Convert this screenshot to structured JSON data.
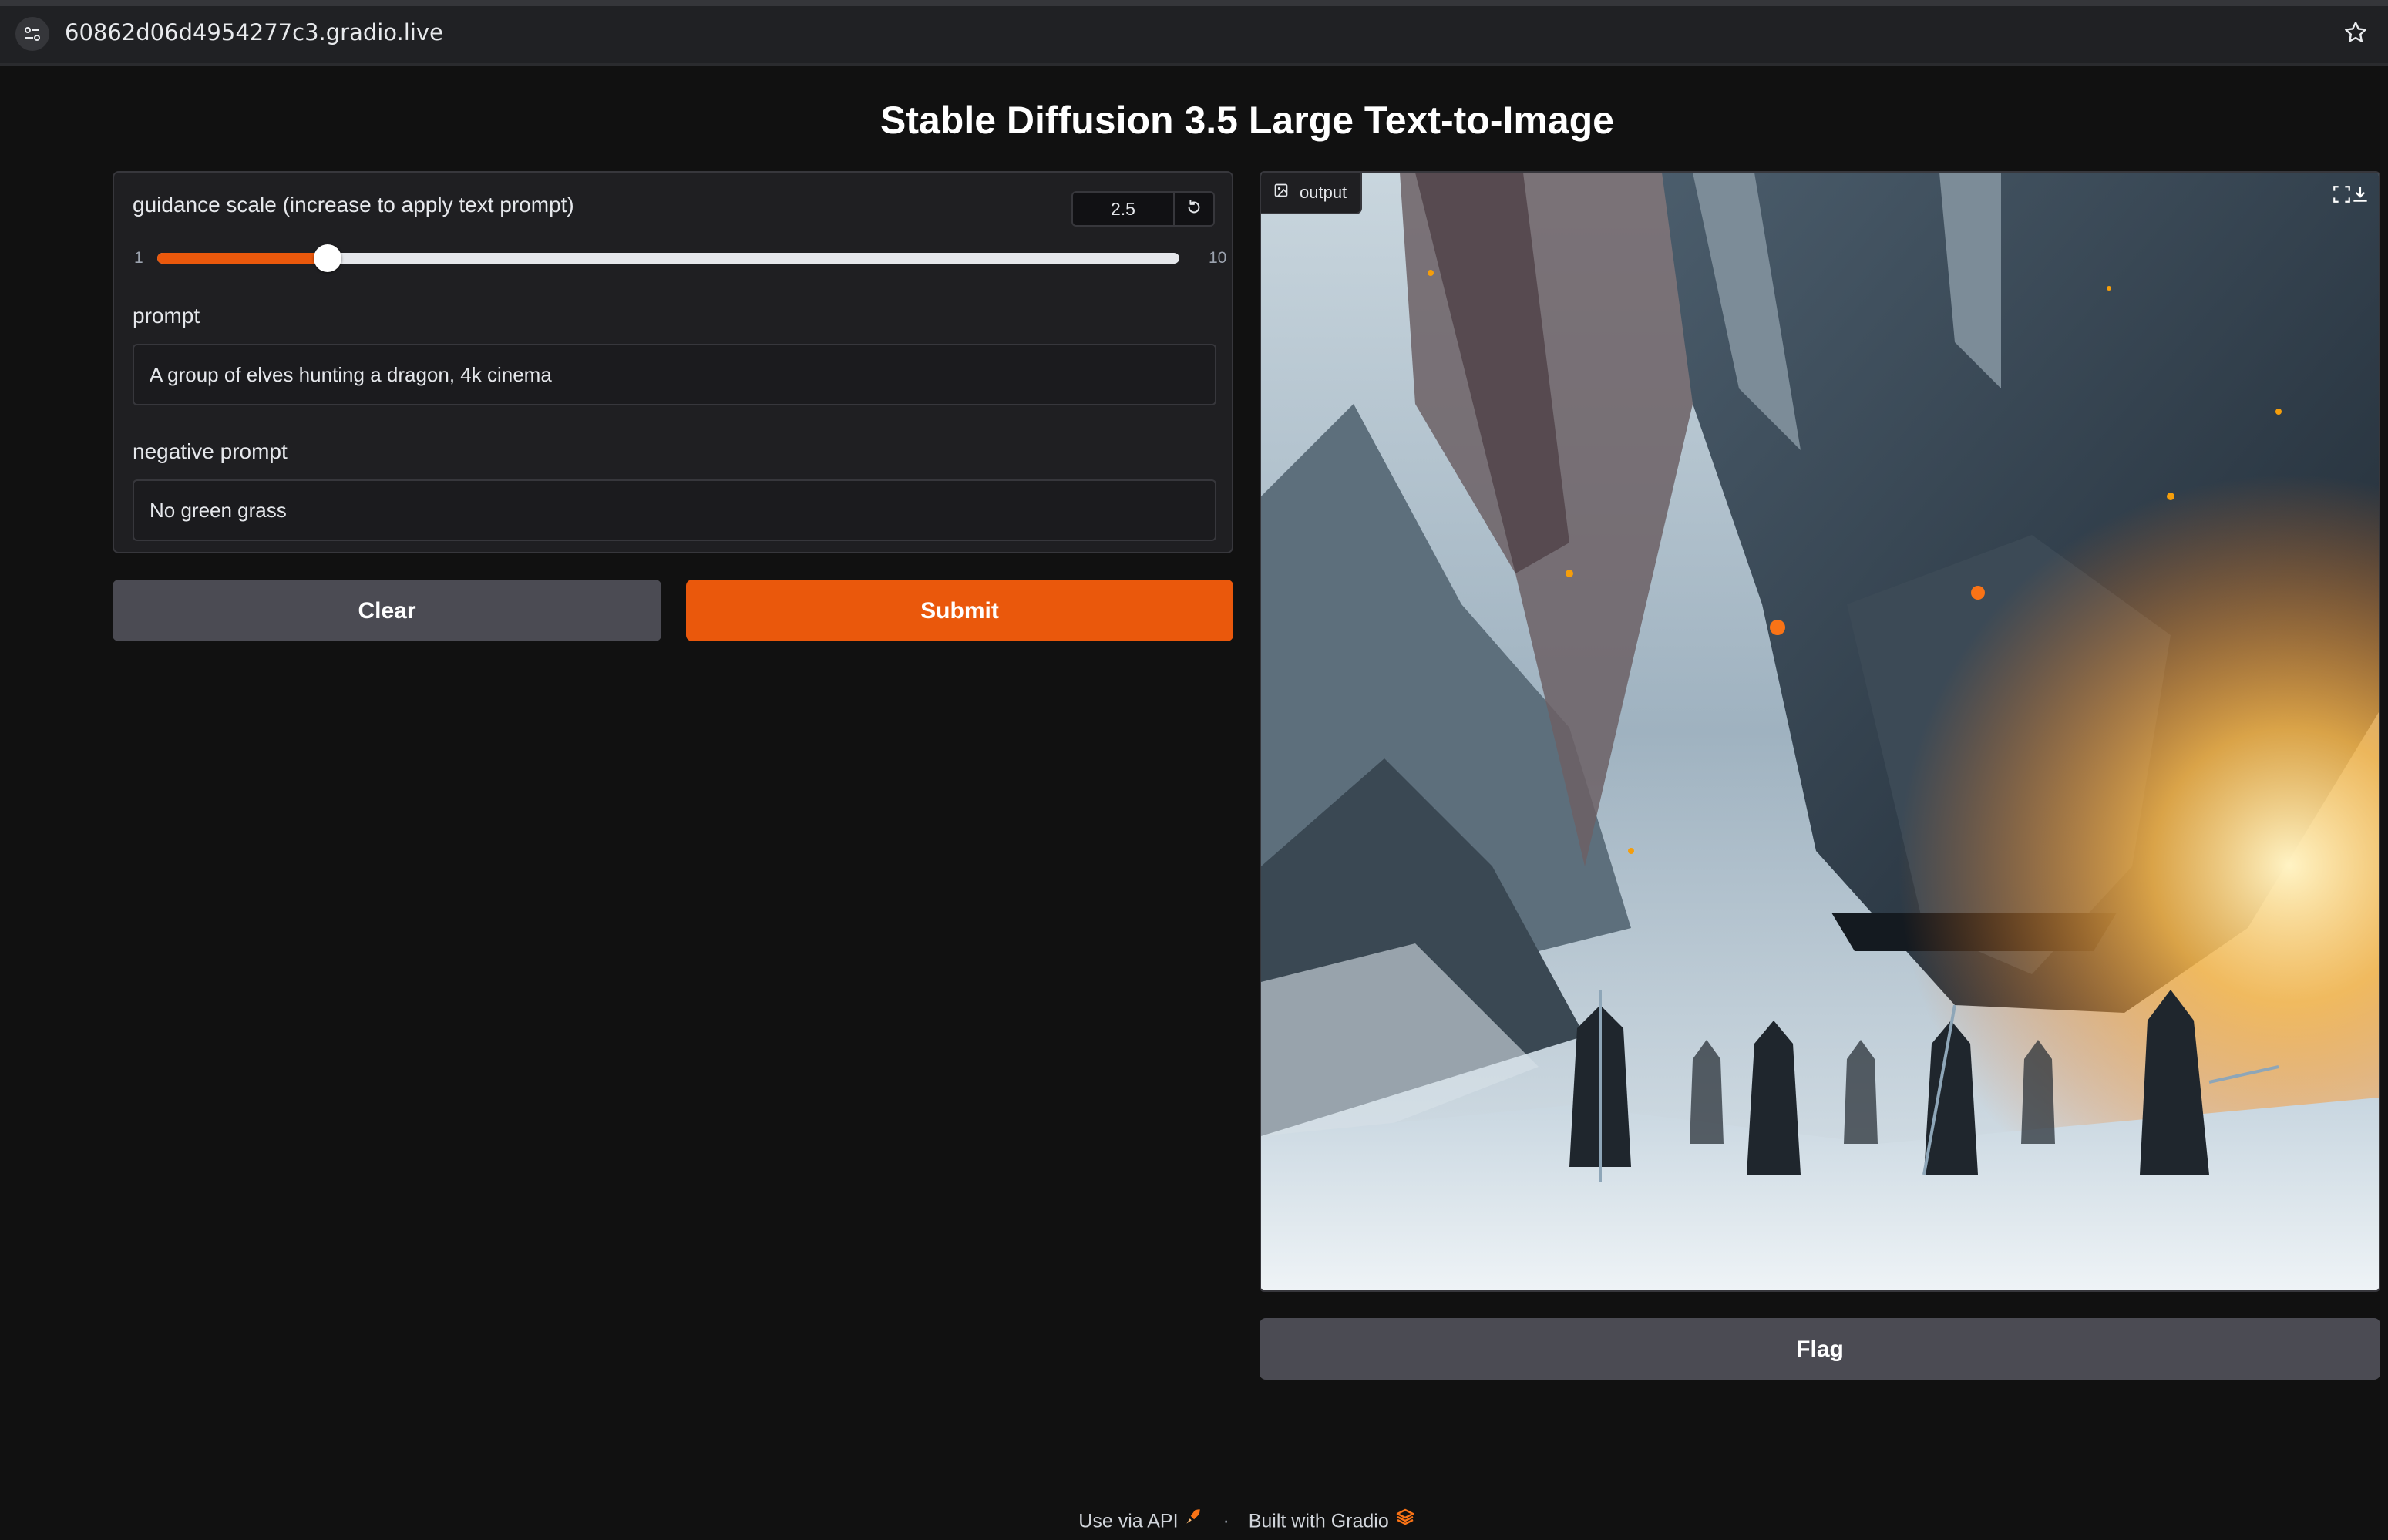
{
  "browser": {
    "url": "60862d06d4954277c3.gradio.live",
    "icons": [
      "site-info-icon",
      "bookmark-star-icon"
    ]
  },
  "app": {
    "title": "Stable Diffusion 3.5 Large Text-to-Image"
  },
  "inputs": {
    "guidance": {
      "label": "guidance scale (increase to apply text prompt)",
      "value": "2.5",
      "min": "1",
      "max": "10",
      "value_fraction": 0.167
    },
    "prompt": {
      "label": "prompt",
      "value": "A group of elves hunting a dragon, 4k cinema"
    },
    "negative_prompt": {
      "label": "negative prompt",
      "value": "No green grass"
    }
  },
  "buttons": {
    "clear": "Clear",
    "submit": "Submit",
    "flag": "Flag"
  },
  "output": {
    "label": "output",
    "icons": [
      "image-icon",
      "fullscreen-icon",
      "download-icon"
    ]
  },
  "footer": {
    "api_link": "Use via API",
    "separator": "·",
    "built_with": "Built with Gradio"
  },
  "colors": {
    "accent": "#ea580c",
    "background": "#111111",
    "panel": "#1f1f22",
    "secondary_button": "#4b4b53"
  }
}
